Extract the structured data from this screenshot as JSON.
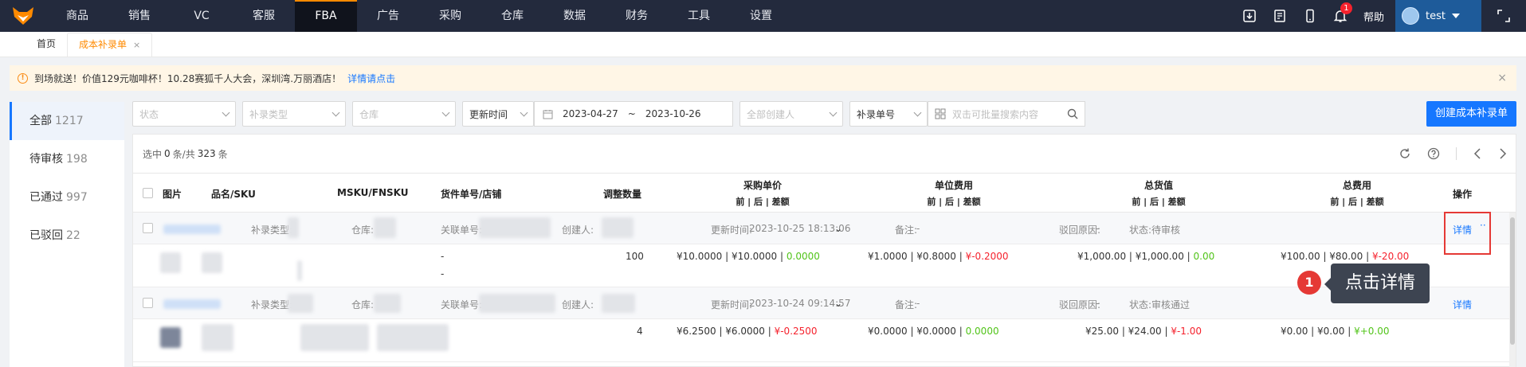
{
  "nav": {
    "items": [
      "商品",
      "销售",
      "VC",
      "客服",
      "FBA",
      "广告",
      "采购",
      "仓库",
      "数据",
      "财务",
      "工具",
      "设置"
    ],
    "active": "FBA",
    "help": "帮助",
    "user": "test",
    "notification_count": "1"
  },
  "tabs": {
    "home": "首页",
    "current": "成本补录单",
    "close": "×"
  },
  "notice": {
    "text": "到场就送！价值129元咖啡杯！10.28赛狐千人大会，深圳湾.万丽酒店！",
    "link": "详情请点击",
    "close": "×"
  },
  "side": {
    "items": [
      {
        "label": "全部",
        "count": "1217"
      },
      {
        "label": "待审核",
        "count": "198"
      },
      {
        "label": "已通过",
        "count": "997"
      },
      {
        "label": "已驳回",
        "count": "22"
      }
    ]
  },
  "filters": {
    "status": "状态",
    "type": "补录类型",
    "warehouse": "仓库",
    "time_field": "更新时间",
    "date_start": "2023-04-27",
    "date_sep": "~",
    "date_end": "2023-10-26",
    "creator": "全部创建人",
    "search_field": "补录单号",
    "search_placeholder": "双击可批量搜索内容",
    "create_button": "创建成本补录单"
  },
  "summary": {
    "prefix": "选中",
    "selected": "0",
    "mid": "条/共",
    "total": "323",
    "suffix": "条"
  },
  "columns": {
    "image": "图片",
    "name_sku": "品名/SKU",
    "msku": "MSKU/FNSKU",
    "shipment": "货件单号/店铺",
    "qty": "调整数量",
    "purchase_price": "采购单价",
    "unit_cost": "单位费用",
    "total_value": "总货值",
    "total_cost": "总费用",
    "actions": "操作",
    "sub": "前 | 后 | 差额"
  },
  "group_labels": {
    "type": "补录类型:",
    "warehouse": "仓库:",
    "ref": "关联单号:",
    "creator": "创建人:",
    "updated": "更新时间:",
    "note": "备注:",
    "reject": "驳回原因:",
    "status": "状态:"
  },
  "records": [
    {
      "updated": "2023-10-25 18:13:06",
      "note": "-",
      "reject": "-",
      "status": "待审核",
      "detail": "详情",
      "more": "··",
      "shipment": "-",
      "shipment2": "-",
      "qty": "100",
      "purchase": {
        "before": "¥10.0000",
        "after": "¥10.0000",
        "diff": "0.0000"
      },
      "unit": {
        "before": "¥1.0000",
        "after": "¥0.8000",
        "diff": "¥-0.2000"
      },
      "value": {
        "before": "¥1,000.00",
        "after": "¥1,000.00",
        "diff": "0.00"
      },
      "cost": {
        "before": "¥100.00",
        "after": "¥80.00",
        "diff": "¥-20.00"
      }
    },
    {
      "updated": "2023-10-24 09:14:57",
      "note": "-",
      "reject": "-",
      "status": "审核通过",
      "detail": "详情",
      "qty": "4",
      "purchase": {
        "before": "¥6.2500",
        "after": "¥6.0000",
        "diff": "¥-0.2500"
      },
      "unit": {
        "before": "¥0.0000",
        "after": "¥0.0000",
        "diff": "0.0000"
      },
      "value": {
        "before": "¥25.00",
        "after": "¥24.00",
        "diff": "¥-1.00"
      },
      "cost": {
        "before": "¥0.00",
        "after": "¥0.00",
        "diff": "¥+0.00"
      }
    }
  ],
  "callout": {
    "step": "1",
    "text": "点击详情"
  },
  "colors": {
    "nav_bg": "#232a3d",
    "accent_orange": "#ff8a00",
    "primary_blue": "#1677ff",
    "negative_red": "#f5222d",
    "positive_green": "#52c41a"
  }
}
